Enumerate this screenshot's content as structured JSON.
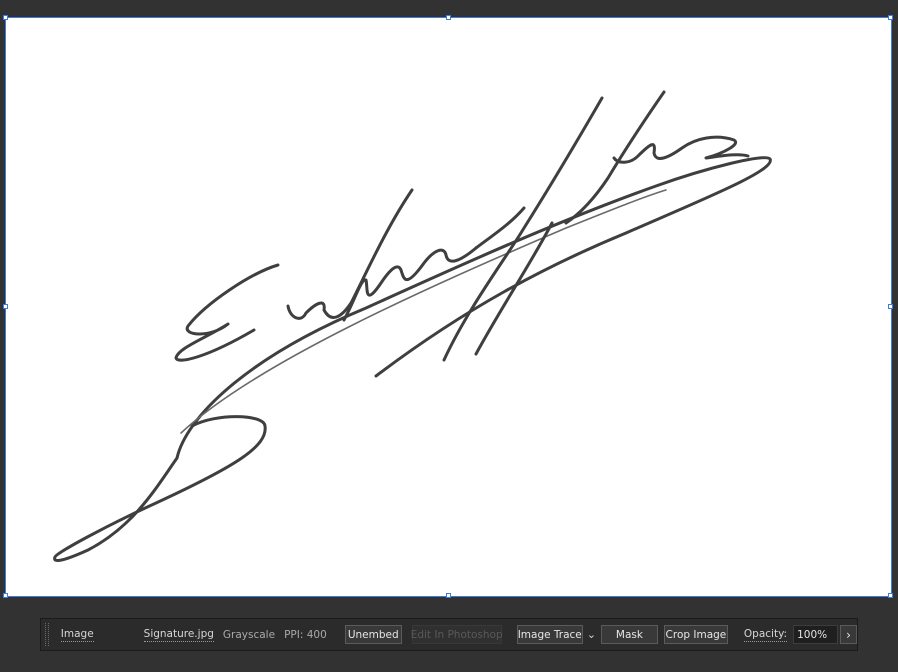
{
  "artboard": {
    "image_name": "Signature.jpg",
    "signature_note": "handwritten signature image"
  },
  "control_bar": {
    "object_type": "Image",
    "file_name": "Signature.jpg",
    "color_mode": "Grayscale",
    "ppi": "PPI: 400",
    "unembed_label": "Unembed",
    "edit_photoshop_label": "Edit In Photoshop",
    "image_trace_label": "Image Trace",
    "image_trace_chevron": "⌄",
    "mask_label": "Mask",
    "crop_label": "Crop Image",
    "opacity_label": "Opacity:",
    "opacity_value": "100%",
    "more_chevron": "›"
  },
  "colors": {
    "workspace": "#323232",
    "selection": "#3d7be0",
    "ink": "#3f3f3f"
  }
}
